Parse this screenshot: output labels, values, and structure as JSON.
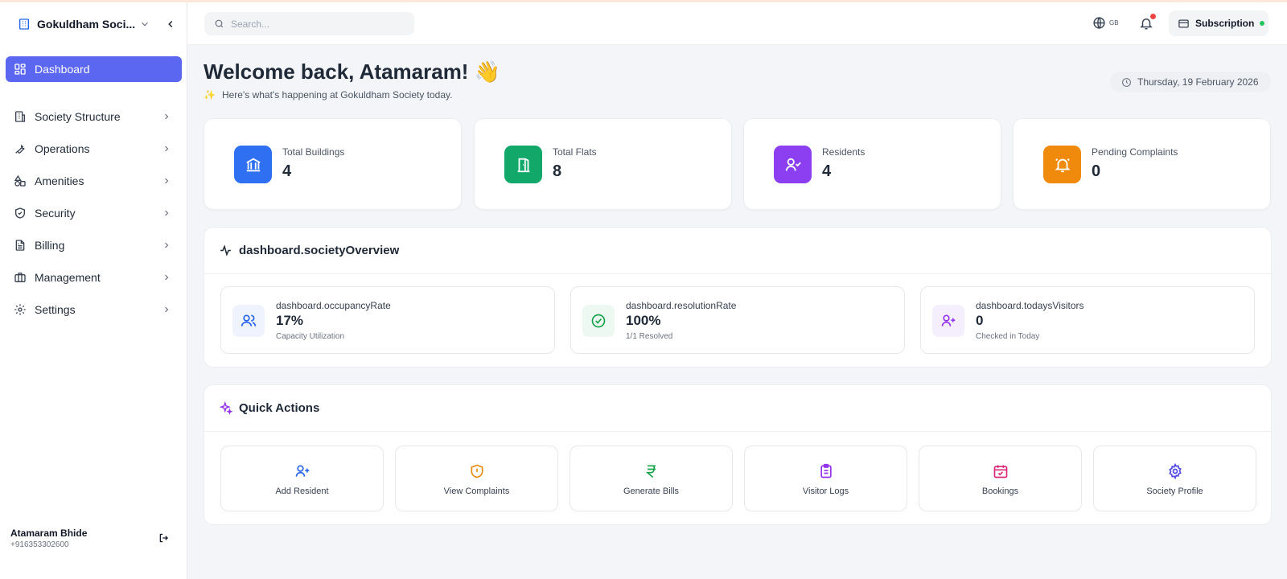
{
  "sidebar": {
    "brand_name": "Gokuldham Soci...",
    "active_item": "Dashboard",
    "items": [
      {
        "label": "Society Structure",
        "icon": "building-icon"
      },
      {
        "label": "Operations",
        "icon": "wrench-icon"
      },
      {
        "label": "Amenities",
        "icon": "shapes-icon"
      },
      {
        "label": "Security",
        "icon": "shield-icon"
      },
      {
        "label": "Billing",
        "icon": "file-text-icon"
      },
      {
        "label": "Management",
        "icon": "briefcase-icon"
      },
      {
        "label": "Settings",
        "icon": "gear-icon"
      }
    ],
    "user": {
      "name": "Atamaram Bhide",
      "phone": "+916353302600"
    }
  },
  "header": {
    "search_placeholder": "Search...",
    "language": "GB",
    "subscription_label": "Subscription"
  },
  "main": {
    "welcome": "Welcome back, Atamaram! 👋",
    "subtitle": "Here's what's happening at Gokuldham Society today.",
    "date": "Thursday, 19 February 2026",
    "stats": [
      {
        "title": "Total Buildings",
        "value": "4",
        "color": "#2f6ff2",
        "icon": "landmark-icon"
      },
      {
        "title": "Total Flats",
        "value": "8",
        "color": "#12a86a",
        "icon": "door-icon"
      },
      {
        "title": "Residents",
        "value": "4",
        "color": "#8b3ff0",
        "icon": "user-check-icon"
      },
      {
        "title": "Pending Complaints",
        "value": "0",
        "color": "#f08a0c",
        "icon": "bell-ring-icon"
      }
    ],
    "overview": {
      "title": "dashboard.societyOverview",
      "cards": [
        {
          "title": "dashboard.occupancyRate",
          "value": "17%",
          "sub": "Capacity Utilization",
          "color": "#2563eb",
          "bg": "#eef3fd",
          "icon": "users-icon"
        },
        {
          "title": "dashboard.resolutionRate",
          "value": "100%",
          "sub": "1/1 Resolved",
          "color": "#16a34a",
          "bg": "#ecf8f1",
          "icon": "check-circle-icon"
        },
        {
          "title": "dashboard.todaysVisitors",
          "value": "0",
          "sub": "Checked in Today",
          "color": "#9333ea",
          "bg": "#f5effd",
          "icon": "user-plus-icon"
        }
      ]
    },
    "quick_actions": {
      "title": "Quick Actions",
      "items": [
        {
          "label": "Add Resident",
          "color": "#2563eb",
          "icon": "user-plus-icon"
        },
        {
          "label": "View Complaints",
          "color": "#ea8a0c",
          "icon": "shield-alert-icon"
        },
        {
          "label": "Generate Bills",
          "color": "#16a34a",
          "icon": "rupee-icon"
        },
        {
          "label": "Visitor Logs",
          "color": "#9333ea",
          "icon": "clipboard-icon"
        },
        {
          "label": "Bookings",
          "color": "#db2777",
          "icon": "calendar-check-icon"
        },
        {
          "label": "Society Profile",
          "color": "#4f46e5",
          "icon": "gear-icon"
        }
      ]
    }
  }
}
